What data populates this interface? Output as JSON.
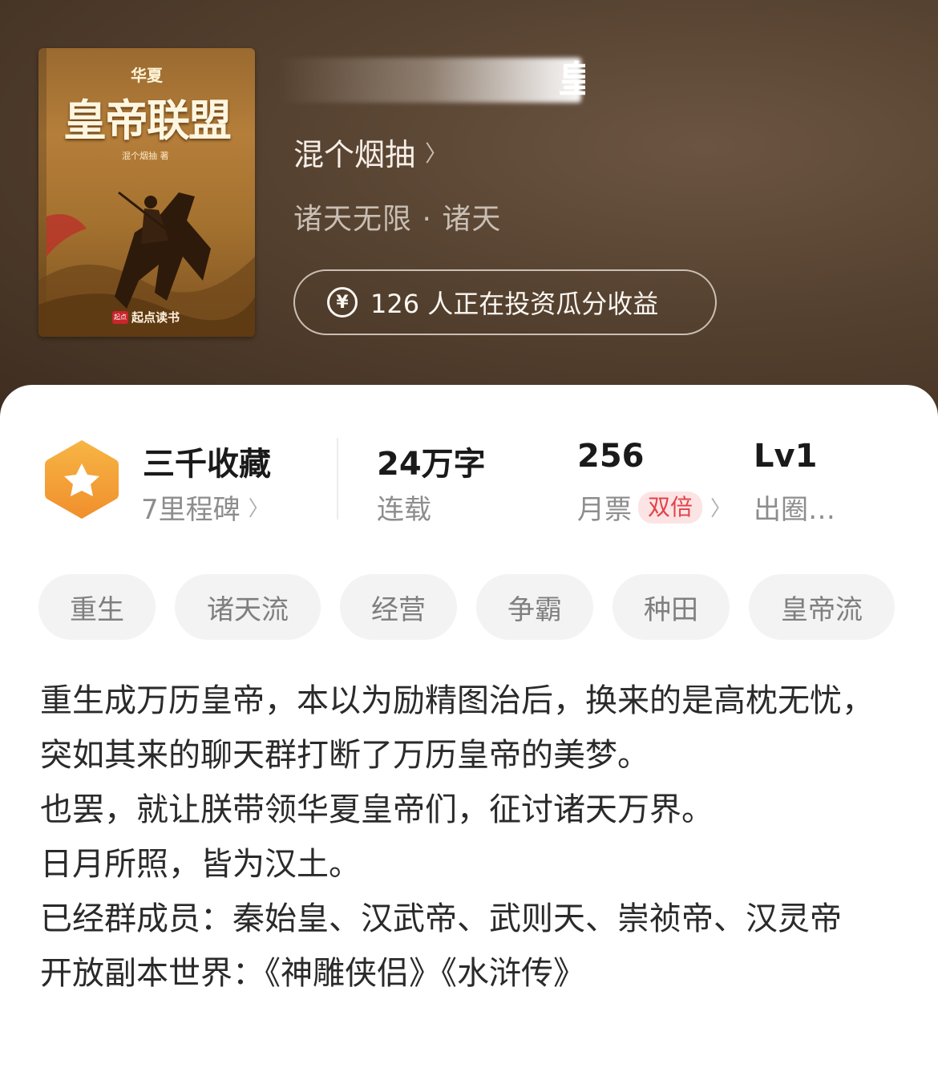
{
  "book": {
    "cover": {
      "series": "华夏",
      "title": "皇帝联盟",
      "author": "混个烟抽 著",
      "publisher": "起点读书",
      "publisher_mark": "起点"
    },
    "title_visible_fragment": "皇",
    "author": "混个烟抽",
    "genre": "诸天无限 · 诸天",
    "invest_text": "126 人正在投资瓜分收益"
  },
  "stats": {
    "collection": {
      "label": "三千收藏",
      "sub": "7里程碑"
    },
    "words": {
      "value": "24万字",
      "sub": "连载"
    },
    "monthly": {
      "value": "256",
      "sub": "月票",
      "tag": "双倍"
    },
    "level": {
      "value": "Lv1",
      "sub": "出圈…"
    }
  },
  "tags": [
    "重生",
    "诸天流",
    "经营",
    "争霸",
    "种田",
    "皇帝流"
  ],
  "intro": [
    "重生成万历皇帝，本以为励精图治后，换来的是高枕无忧，突如其来的聊天群打断了万历皇帝的美梦。",
    "也罢，就让朕带领华夏皇帝们，征讨诸天万界。",
    "日月所照，皆为汉土。",
    "已经群成员：秦始皇、汉武帝、武则天、崇祯帝、汉灵帝",
    "开放副本世界：《神雕侠侣》《水浒传》"
  ],
  "colors": {
    "header_bg": "#55412f",
    "badge_orange": "#f2a23a",
    "double_tag_text": "#e0434a",
    "double_tag_bg": "#fde4e4"
  },
  "icons": [
    "yen-icon",
    "star-badge-icon",
    "chevron-right-icon"
  ]
}
